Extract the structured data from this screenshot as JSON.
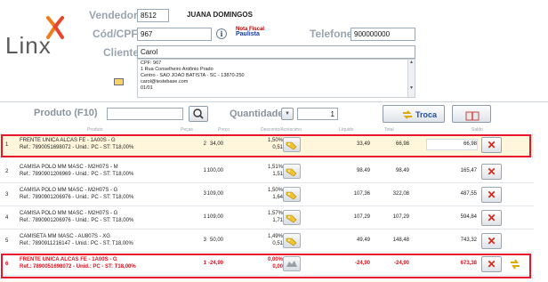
{
  "brand": {
    "logo_text": "Linx"
  },
  "header": {
    "vendedor_label": "Vendedor",
    "vendedor_code": "8512",
    "vendedor_name": "JUANA DOMINGOS",
    "cpf_label": "Cód/CPF",
    "cpf_value": "967",
    "nota_fiscal_top": "Nota Fiscal",
    "nota_fiscal_bottom": "Paulista",
    "telefone_label": "Telefone",
    "telefone_value": "900000000",
    "cliente_label": "Cliente",
    "cliente_value": "Carol",
    "address_lines": [
      "CPF: 967",
      "1 Rua Conselheiro Antônio Prado",
      "Centro - SAO JOAO BATISTA - SC - 13870-250",
      "carol@testebase.com",
      "01/01"
    ]
  },
  "product_bar": {
    "produto_label": "Produto (F10)",
    "quantidade_label": "Quantidade",
    "quantidade_value": "1",
    "troca_label": "Troca"
  },
  "table_headers": [
    "Produto",
    "Peças",
    "Preço",
    "Desconto/Acréscimo",
    "Líquido",
    "Total",
    "Saldo"
  ],
  "rows": [
    {
      "n": "1",
      "desc": "FRENTE UNICA ALCAS FE - 1A00S - G",
      "ref": "Ref.: 7890051698072 - Unid.: PC - ST: T18,00%",
      "qty": "2",
      "price": "34,00",
      "disc_pct": "1,50%",
      "disc_val": "0,51",
      "liq": "33,49",
      "total": "66,98",
      "saldo": "66,98"
    },
    {
      "n": "2",
      "desc": "CAMISA POLO MM MASC - M2H07S - M",
      "ref": "Ref.: 7890901206969 - Unid.: PC - ST: T18,00%",
      "qty": "1",
      "price": "100,00",
      "disc_pct": "1,51%",
      "disc_val": "1,51",
      "liq": "98,49",
      "total": "98,49",
      "saldo": "165,47"
    },
    {
      "n": "3",
      "desc": "CAMISA POLO MM MASC - M2H07S - G",
      "ref": "Ref.: 7890901206976 - Unid.: PC - ST: T18,00%",
      "qty": "3",
      "price": "109,00",
      "disc_pct": "1,50%",
      "disc_val": "1,64",
      "liq": "107,36",
      "total": "322,08",
      "saldo": "487,55"
    },
    {
      "n": "4",
      "desc": "CAMISA POLO MM MASC - M2H07S - G",
      "ref": "Ref.: 7890901206976 - Unid.: PC - ST: T18,00%",
      "qty": "1",
      "price": "109,00",
      "disc_pct": "1,57%",
      "disc_val": "1,71",
      "liq": "107,29",
      "total": "107,29",
      "saldo": "594,84"
    },
    {
      "n": "5",
      "desc": "CAMISETA MM MASC - AU807S - XG",
      "ref": "Ref.: 7890911216147 - Unid.: PC - ST: T18,00%",
      "qty": "3",
      "price": "50,00",
      "disc_pct": "1,49%",
      "disc_val": "0,51",
      "liq": "49,49",
      "total": "148,48",
      "saldo": "743,32"
    },
    {
      "n": "6",
      "desc": "FRENTE UNICA ALCAS FE - 1A00S - G",
      "ref": "Ref.: 7890051698072 - Unid.: PC - ST: T18,00%",
      "qty": "1",
      "price": "-24,90",
      "disc_pct": "0,00%",
      "disc_val": "0,00",
      "liq": "-24,90",
      "total": "-24,90",
      "saldo": "673,38"
    }
  ],
  "colors": {
    "highlight": "#e8162a",
    "row1_bg": "#fff6dc",
    "label": "#9aa4b0",
    "accent": "#e36c1c"
  }
}
